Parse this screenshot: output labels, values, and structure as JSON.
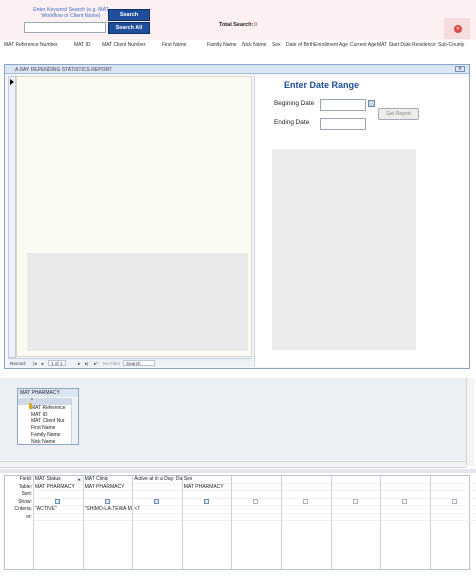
{
  "search": {
    "hint": "Enter Keyword Search (e.g. MAT Workflow or Client Name)",
    "search_label": "Search",
    "search_all_label": "Search All",
    "total_label": "Total Search:",
    "total_value": "0"
  },
  "columns": [
    "MAT Reference Number",
    "MAT ID",
    "MAT Client Number",
    "First Name",
    "Family Name",
    "Nick Name",
    "Sex",
    "Date of Birth",
    "Enrollment Age",
    "Current Age",
    "MAT Start Date",
    "Residence",
    "Sub-County"
  ],
  "report": {
    "title": "A DAY DEPENDING STATISTICS REPORT",
    "date_range_title": "Enter Date Range",
    "begin_label": "Begining Date",
    "end_label": "Ending Date",
    "get_report_label": "Get Report",
    "nav": {
      "record_label": "Record:",
      "position": "1 of 1",
      "filter": "No Filter",
      "search": "Search"
    }
  },
  "table": {
    "name": "MAT PHARMACY",
    "fields": [
      "*",
      "MAT Reference",
      "MAT ID",
      "MAT Client Nur",
      "First Name",
      "Family Name",
      "Nick Name"
    ]
  },
  "grid": {
    "row_labels": [
      "Field:",
      "Table:",
      "Sort:",
      "Show:",
      "Criteria:",
      "or:"
    ],
    "columns": [
      {
        "field": "MAT Status",
        "table": "MAT PHARMACY",
        "show": true,
        "criteria": "\"ACTIVE\""
      },
      {
        "field": "MAT Clinic",
        "table": "MAT PHARMACY",
        "show": true,
        "criteria": "\"SHIMO-LA-TEWA MA"
      },
      {
        "field": "Active at in a Day: Dat",
        "table": "",
        "show": true,
        "criteria": "<7"
      },
      {
        "field": "Sex",
        "table": "MAT PHARMACY",
        "show": true,
        "criteria": ""
      },
      {
        "field": "",
        "table": "",
        "show": false,
        "criteria": ""
      },
      {
        "field": "",
        "table": "",
        "show": false,
        "criteria": ""
      },
      {
        "field": "",
        "table": "",
        "show": false,
        "criteria": ""
      },
      {
        "field": "",
        "table": "",
        "show": false,
        "criteria": ""
      },
      {
        "field": "",
        "table": "",
        "show": false,
        "criteria": ""
      }
    ]
  }
}
